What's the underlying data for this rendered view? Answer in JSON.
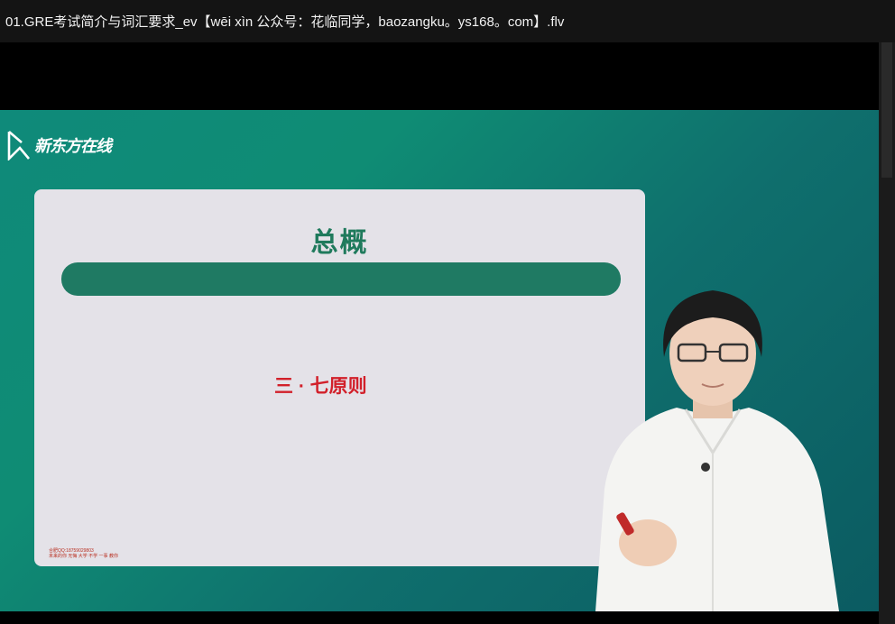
{
  "window": {
    "title": "01.GRE考试简介与词汇要求_ev【wēi xìn 公众号：花临同学，baozangku。ys168。com】.flv"
  },
  "video": {
    "logo_text": "新东方在线",
    "slide": {
      "title": "总概",
      "subtitle": "三 · 七原则",
      "footer_line1": "合肥QQ:18759029803",
      "footer_line2": "未来的你 无悔 大学 不学 一事 教你"
    }
  },
  "colors": {
    "accent_green": "#1f7a63",
    "title_green": "#1f7a5c",
    "subtitle_red": "#d2202a",
    "video_bg": "#0f8a7a"
  }
}
